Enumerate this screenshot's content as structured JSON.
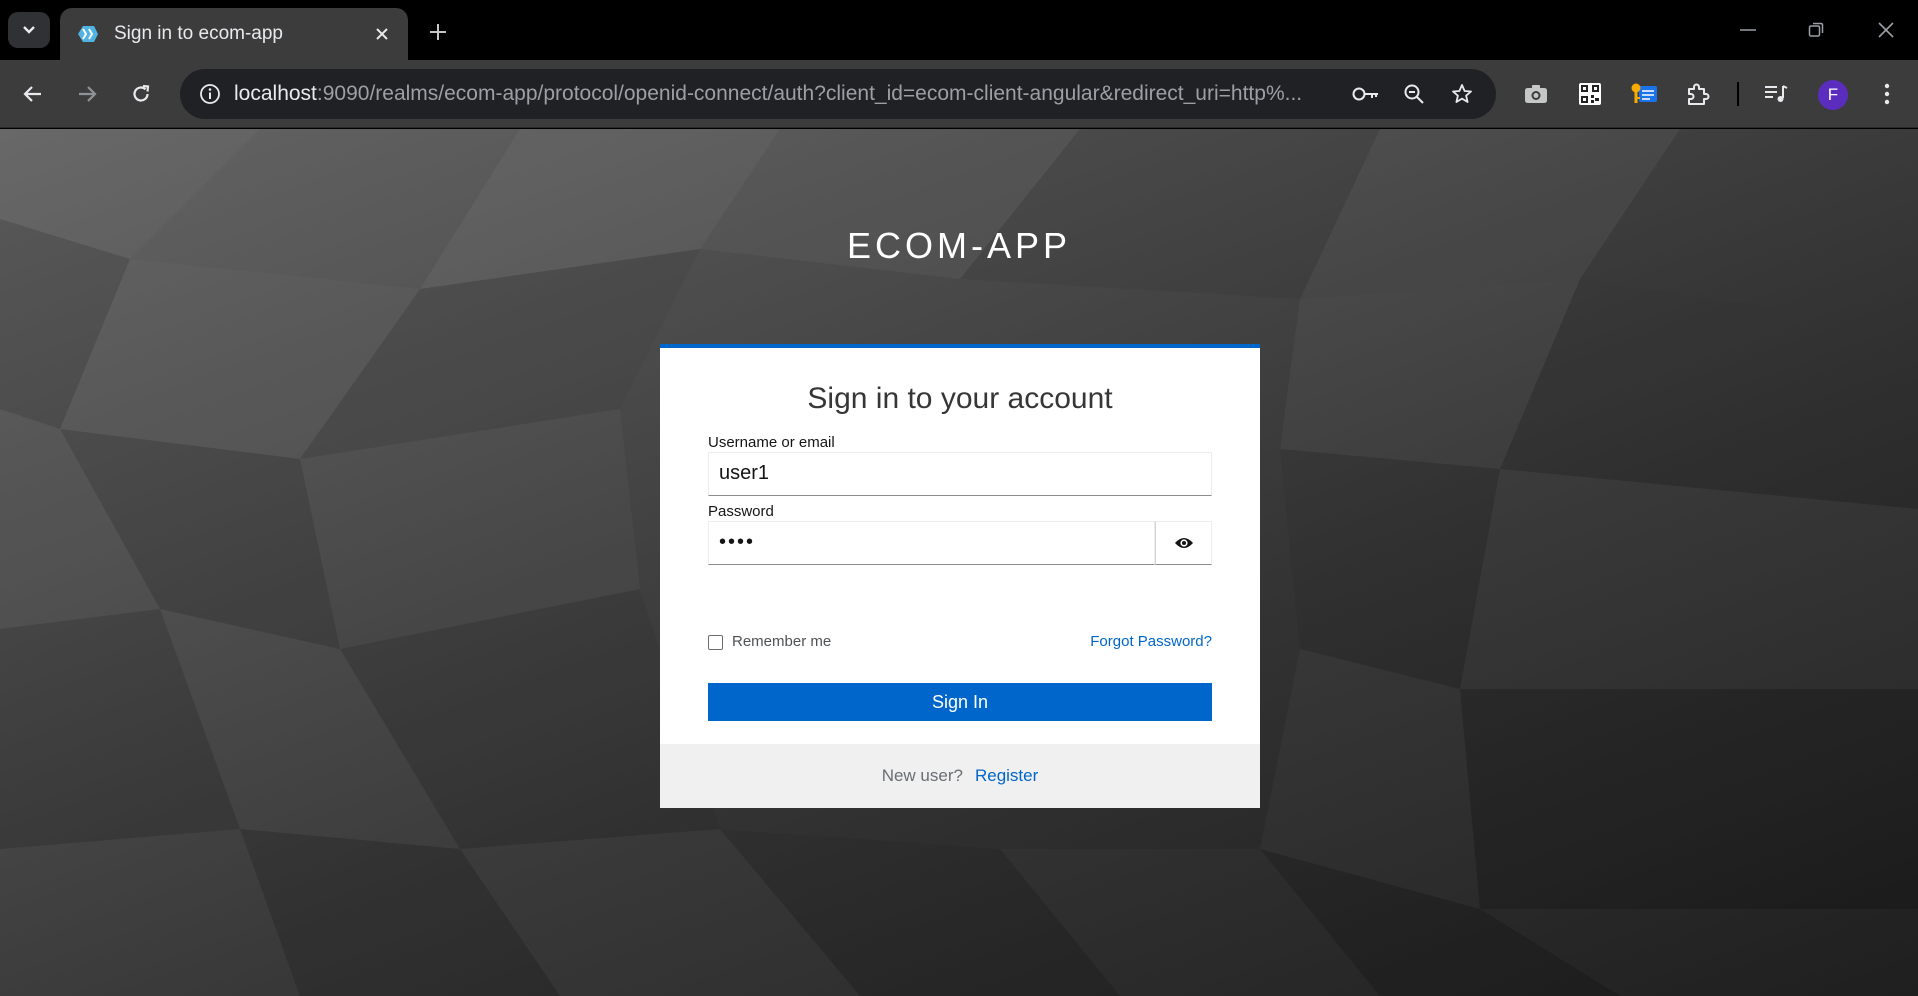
{
  "browser": {
    "tab": {
      "title": "Sign in to ecom-app"
    },
    "address_bar": {
      "host": "localhost",
      "rest": ":9090/realms/ecom-app/protocol/openid-connect/auth?client_id=ecom-client-angular&redirect_uri=http%..."
    },
    "profile_initial": "F"
  },
  "page": {
    "realm_name": "ECOM-APP",
    "heading": "Sign in to your account",
    "username": {
      "label": "Username or email",
      "value": "user1"
    },
    "password": {
      "label": "Password",
      "value": "••••"
    },
    "remember_me_label": "Remember me",
    "forgot_password_link": "Forgot Password?",
    "sign_in_button": "Sign In",
    "new_user_text": "New user?",
    "register_link": "Register"
  },
  "colors": {
    "primary": "#0066cc",
    "card_accent": "#0066cc",
    "chrome_bg": "#3c3c3c",
    "avatar": "#5b2dbf"
  },
  "icons": [
    "chevron-down-icon",
    "favicon-icon",
    "close-icon",
    "plus-icon",
    "minimize-icon",
    "restore-icon",
    "back-icon",
    "forward-icon",
    "reload-icon",
    "info-icon",
    "key-icon",
    "zoom-icon",
    "star-icon",
    "camera-icon",
    "qr-code-icon",
    "key-extension-icon",
    "puzzle-icon",
    "media-queue-icon",
    "more-vert-icon",
    "eye-icon"
  ]
}
